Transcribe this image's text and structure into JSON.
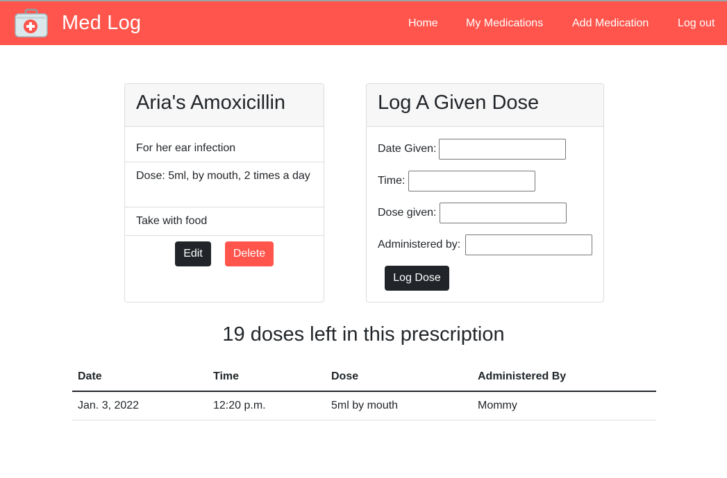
{
  "navbar": {
    "brand": "Med Log",
    "links": [
      "Home",
      "My Medications",
      "Add Medication",
      "Log out"
    ]
  },
  "medication_card": {
    "title": "Aria's Amoxicillin",
    "purpose": "For her ear infection",
    "dose": "Dose: 5ml, by mouth, 2 times a day",
    "instructions": "Take with food",
    "edit_label": "Edit",
    "delete_label": "Delete"
  },
  "log_form": {
    "title": "Log A Given Dose",
    "fields": [
      {
        "label": "Date Given:",
        "value": ""
      },
      {
        "label": "Time:",
        "value": ""
      },
      {
        "label": "Dose given:",
        "value": ""
      },
      {
        "label": "Administered by:",
        "value": ""
      }
    ],
    "submit_label": "Log Dose"
  },
  "doses_left": "19 doses left in this prescription",
  "table": {
    "headers": [
      "Date",
      "Time",
      "Dose",
      "Administered By"
    ],
    "rows": [
      [
        "Jan. 3, 2022",
        "12:20 p.m.",
        "5ml by mouth",
        "Mommy"
      ]
    ]
  },
  "colors": {
    "navbar": "#ff554c",
    "dark_button": "#212529",
    "delete_button": "#ff554c"
  }
}
